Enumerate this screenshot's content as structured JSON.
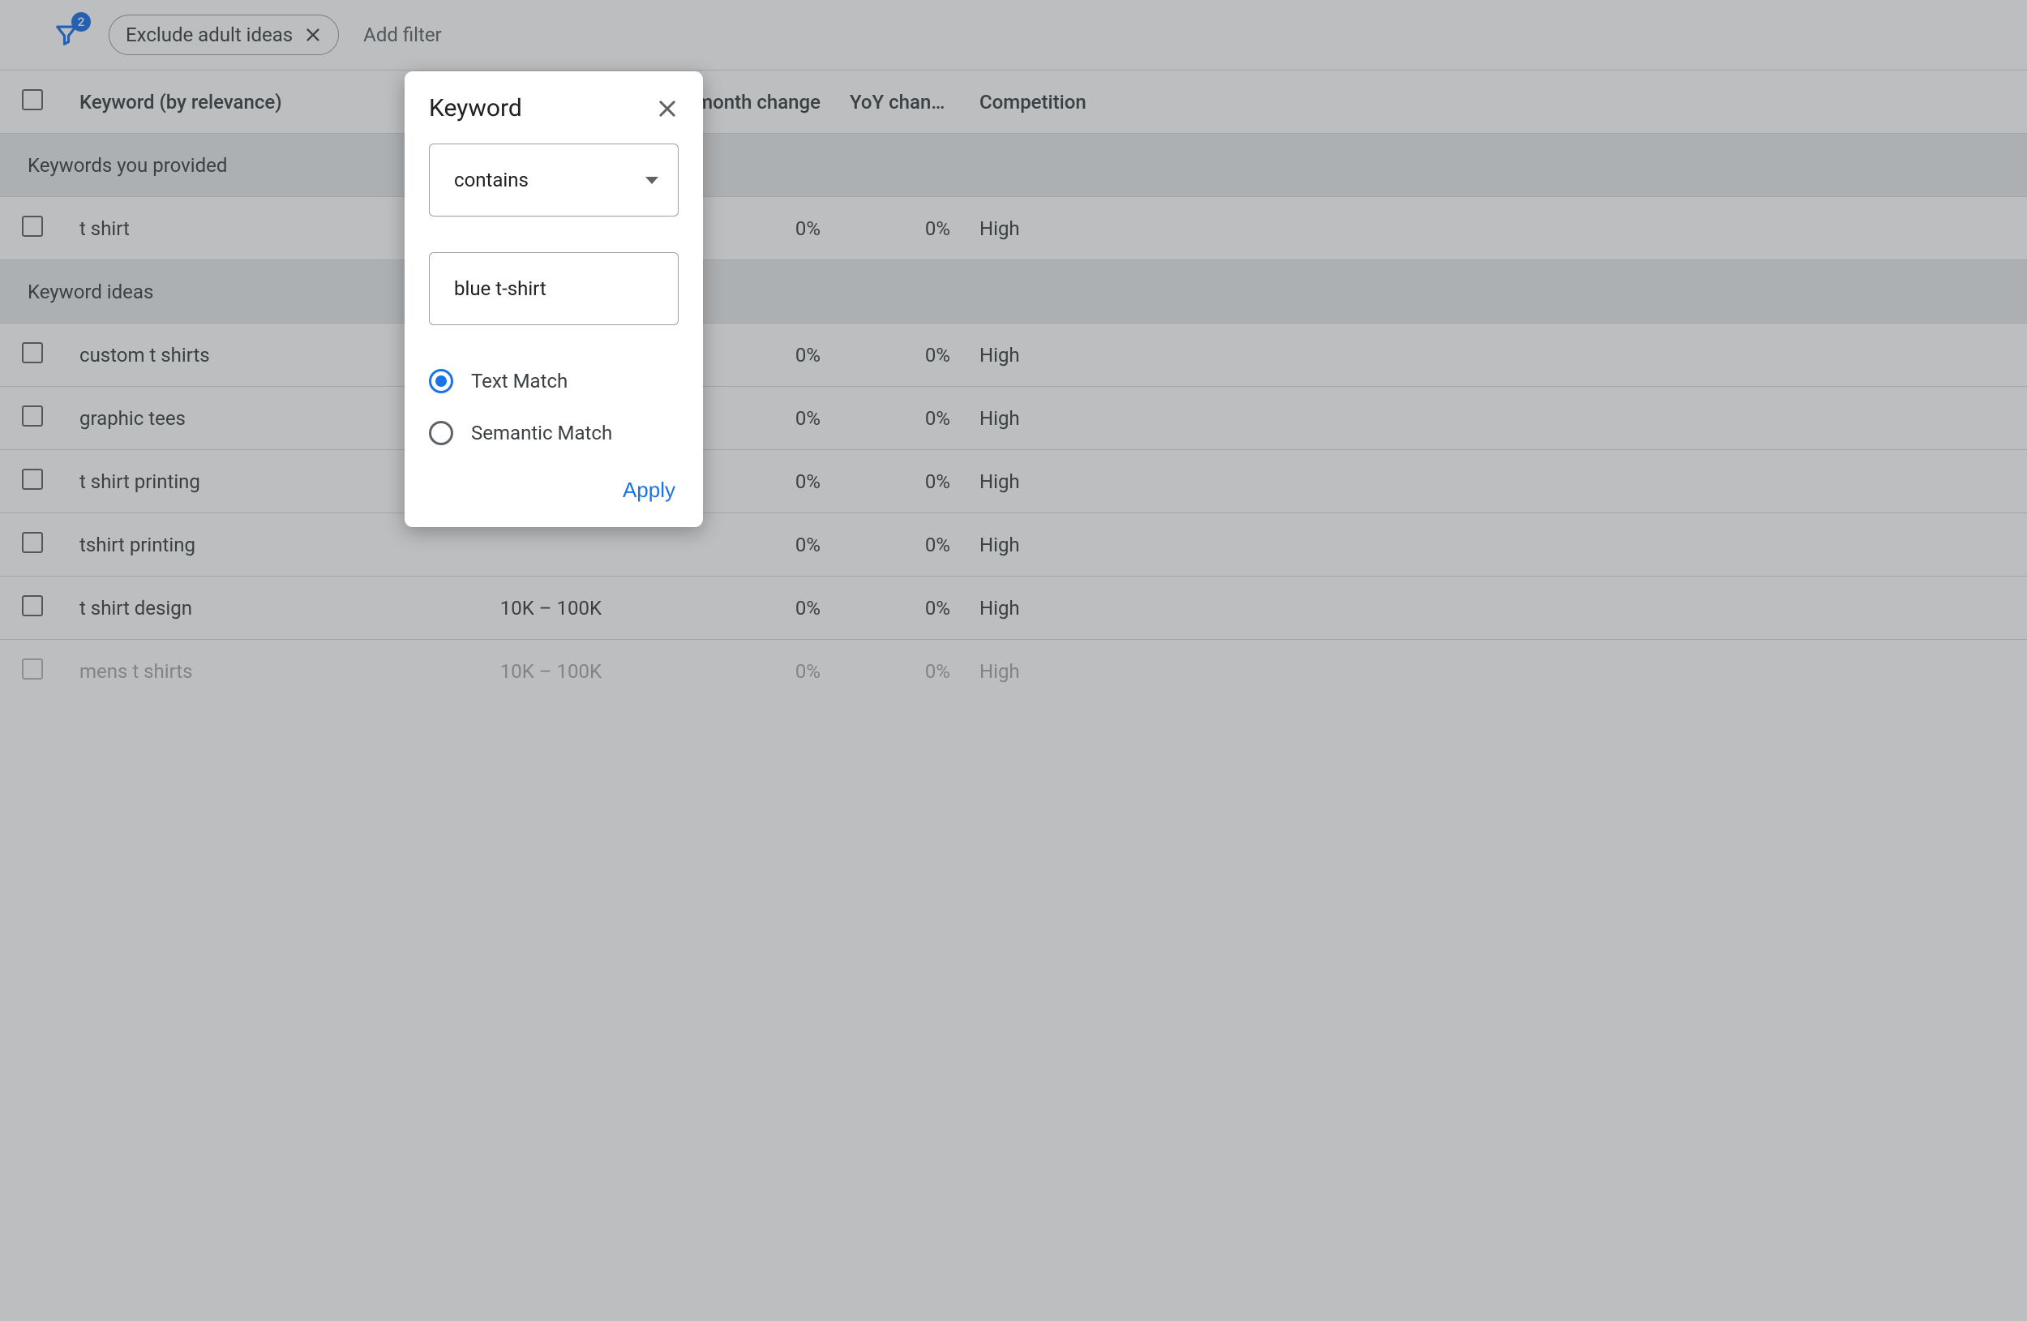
{
  "filter_bar": {
    "badge_count": "2",
    "chip_label": "Exclude adult ideas",
    "add_filter_label": "Add filter"
  },
  "table": {
    "headers": {
      "keyword": "Keyword (by relevance)",
      "volume": "",
      "three_month": "Three month change",
      "yoy": "YoY change",
      "competition": "Competition"
    },
    "section_provided": "Keywords you provided",
    "section_ideas": "Keyword ideas",
    "rows_provided": [
      {
        "keyword": "t shirt",
        "volume": "",
        "three_month": "0%",
        "yoy": "0%",
        "competition": "High"
      }
    ],
    "rows_ideas": [
      {
        "keyword": "custom t shirts",
        "volume": "",
        "three_month": "0%",
        "yoy": "0%",
        "competition": "High"
      },
      {
        "keyword": "graphic tees",
        "volume": "",
        "three_month": "0%",
        "yoy": "0%",
        "competition": "High"
      },
      {
        "keyword": "t shirt printing",
        "volume": "",
        "three_month": "0%",
        "yoy": "0%",
        "competition": "High"
      },
      {
        "keyword": "tshirt printing",
        "volume": "",
        "three_month": "0%",
        "yoy": "0%",
        "competition": "High"
      },
      {
        "keyword": "t shirt design",
        "volume": "10K – 100K",
        "three_month": "0%",
        "yoy": "0%",
        "competition": "High"
      },
      {
        "keyword": "mens t shirts",
        "volume": "10K – 100K",
        "three_month": "0%",
        "yoy": "0%",
        "competition": "High"
      }
    ]
  },
  "popover": {
    "title": "Keyword",
    "select_value": "contains",
    "input_value": "blue t-shirt",
    "radio_text": "Text Match",
    "radio_semantic": "Semantic Match",
    "apply_label": "Apply"
  }
}
